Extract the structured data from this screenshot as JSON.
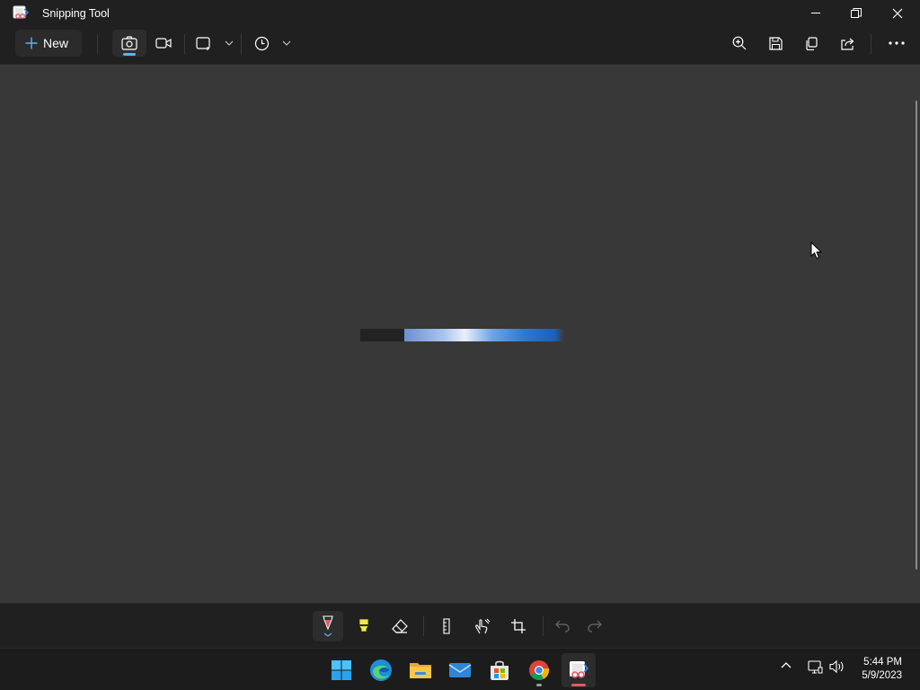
{
  "window": {
    "title": "Snipping Tool"
  },
  "toolbar": {
    "new_label": "New",
    "mode": "snip",
    "shape": "rectangle",
    "timer": "no delay"
  },
  "editor_tools": [
    "ballpoint-pen",
    "highlighter",
    "eraser",
    "ruler",
    "touch-writing",
    "image-crop",
    "undo",
    "redo"
  ],
  "taskbar": {
    "apps": [
      "Start",
      "Microsoft Edge",
      "File Explorer",
      "Mail",
      "Microsoft Store",
      "Google Chrome",
      "Snipping Tool"
    ],
    "time": "5:44 PM",
    "date": "5/9/2023"
  },
  "colors": {
    "accent": "#5fb2f2",
    "pen": "#e05a6a",
    "highlighter": "#f2e84a"
  }
}
